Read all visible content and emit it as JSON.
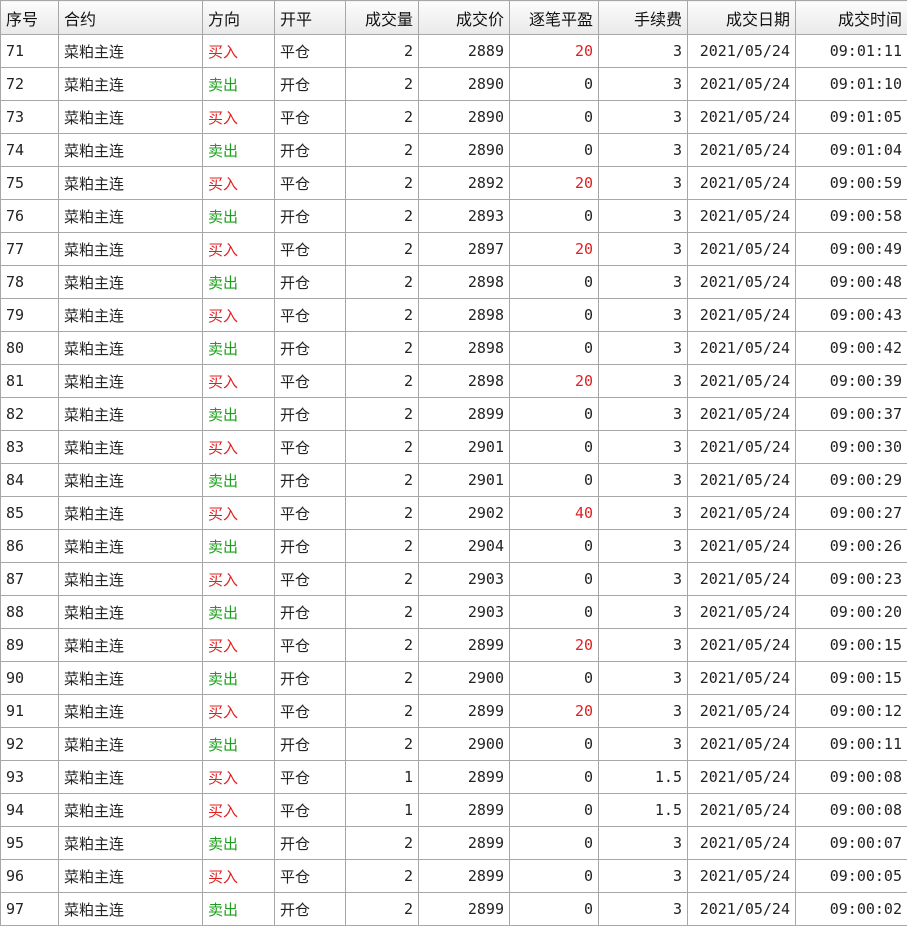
{
  "columns": [
    "序号",
    "合约",
    "方向",
    "开平",
    "成交量",
    "成交价",
    "逐笔平盈",
    "手续费",
    "成交日期",
    "成交时间"
  ],
  "colors": {
    "buy": "#e02020",
    "sell": "#1aa01a",
    "profit": "#e02020"
  },
  "rows": [
    [
      "71",
      "菜粕主连",
      "买入",
      "平仓",
      "2",
      "2889",
      "20",
      "3",
      "2021/05/24",
      "09:01:11"
    ],
    [
      "72",
      "菜粕主连",
      "卖出",
      "开仓",
      "2",
      "2890",
      "0",
      "3",
      "2021/05/24",
      "09:01:10"
    ],
    [
      "73",
      "菜粕主连",
      "买入",
      "平仓",
      "2",
      "2890",
      "0",
      "3",
      "2021/05/24",
      "09:01:05"
    ],
    [
      "74",
      "菜粕主连",
      "卖出",
      "开仓",
      "2",
      "2890",
      "0",
      "3",
      "2021/05/24",
      "09:01:04"
    ],
    [
      "75",
      "菜粕主连",
      "买入",
      "平仓",
      "2",
      "2892",
      "20",
      "3",
      "2021/05/24",
      "09:00:59"
    ],
    [
      "76",
      "菜粕主连",
      "卖出",
      "开仓",
      "2",
      "2893",
      "0",
      "3",
      "2021/05/24",
      "09:00:58"
    ],
    [
      "77",
      "菜粕主连",
      "买入",
      "平仓",
      "2",
      "2897",
      "20",
      "3",
      "2021/05/24",
      "09:00:49"
    ],
    [
      "78",
      "菜粕主连",
      "卖出",
      "开仓",
      "2",
      "2898",
      "0",
      "3",
      "2021/05/24",
      "09:00:48"
    ],
    [
      "79",
      "菜粕主连",
      "买入",
      "平仓",
      "2",
      "2898",
      "0",
      "3",
      "2021/05/24",
      "09:00:43"
    ],
    [
      "80",
      "菜粕主连",
      "卖出",
      "开仓",
      "2",
      "2898",
      "0",
      "3",
      "2021/05/24",
      "09:00:42"
    ],
    [
      "81",
      "菜粕主连",
      "买入",
      "平仓",
      "2",
      "2898",
      "20",
      "3",
      "2021/05/24",
      "09:00:39"
    ],
    [
      "82",
      "菜粕主连",
      "卖出",
      "开仓",
      "2",
      "2899",
      "0",
      "3",
      "2021/05/24",
      "09:00:37"
    ],
    [
      "83",
      "菜粕主连",
      "买入",
      "平仓",
      "2",
      "2901",
      "0",
      "3",
      "2021/05/24",
      "09:00:30"
    ],
    [
      "84",
      "菜粕主连",
      "卖出",
      "开仓",
      "2",
      "2901",
      "0",
      "3",
      "2021/05/24",
      "09:00:29"
    ],
    [
      "85",
      "菜粕主连",
      "买入",
      "平仓",
      "2",
      "2902",
      "40",
      "3",
      "2021/05/24",
      "09:00:27"
    ],
    [
      "86",
      "菜粕主连",
      "卖出",
      "开仓",
      "2",
      "2904",
      "0",
      "3",
      "2021/05/24",
      "09:00:26"
    ],
    [
      "87",
      "菜粕主连",
      "买入",
      "平仓",
      "2",
      "2903",
      "0",
      "3",
      "2021/05/24",
      "09:00:23"
    ],
    [
      "88",
      "菜粕主连",
      "卖出",
      "开仓",
      "2",
      "2903",
      "0",
      "3",
      "2021/05/24",
      "09:00:20"
    ],
    [
      "89",
      "菜粕主连",
      "买入",
      "平仓",
      "2",
      "2899",
      "20",
      "3",
      "2021/05/24",
      "09:00:15"
    ],
    [
      "90",
      "菜粕主连",
      "卖出",
      "开仓",
      "2",
      "2900",
      "0",
      "3",
      "2021/05/24",
      "09:00:15"
    ],
    [
      "91",
      "菜粕主连",
      "买入",
      "平仓",
      "2",
      "2899",
      "20",
      "3",
      "2021/05/24",
      "09:00:12"
    ],
    [
      "92",
      "菜粕主连",
      "卖出",
      "开仓",
      "2",
      "2900",
      "0",
      "3",
      "2021/05/24",
      "09:00:11"
    ],
    [
      "93",
      "菜粕主连",
      "买入",
      "平仓",
      "1",
      "2899",
      "0",
      "1.5",
      "2021/05/24",
      "09:00:08"
    ],
    [
      "94",
      "菜粕主连",
      "买入",
      "平仓",
      "1",
      "2899",
      "0",
      "1.5",
      "2021/05/24",
      "09:00:08"
    ],
    [
      "95",
      "菜粕主连",
      "卖出",
      "开仓",
      "2",
      "2899",
      "0",
      "3",
      "2021/05/24",
      "09:00:07"
    ],
    [
      "96",
      "菜粕主连",
      "买入",
      "平仓",
      "2",
      "2899",
      "0",
      "3",
      "2021/05/24",
      "09:00:05"
    ],
    [
      "97",
      "菜粕主连",
      "卖出",
      "开仓",
      "2",
      "2899",
      "0",
      "3",
      "2021/05/24",
      "09:00:02"
    ]
  ]
}
